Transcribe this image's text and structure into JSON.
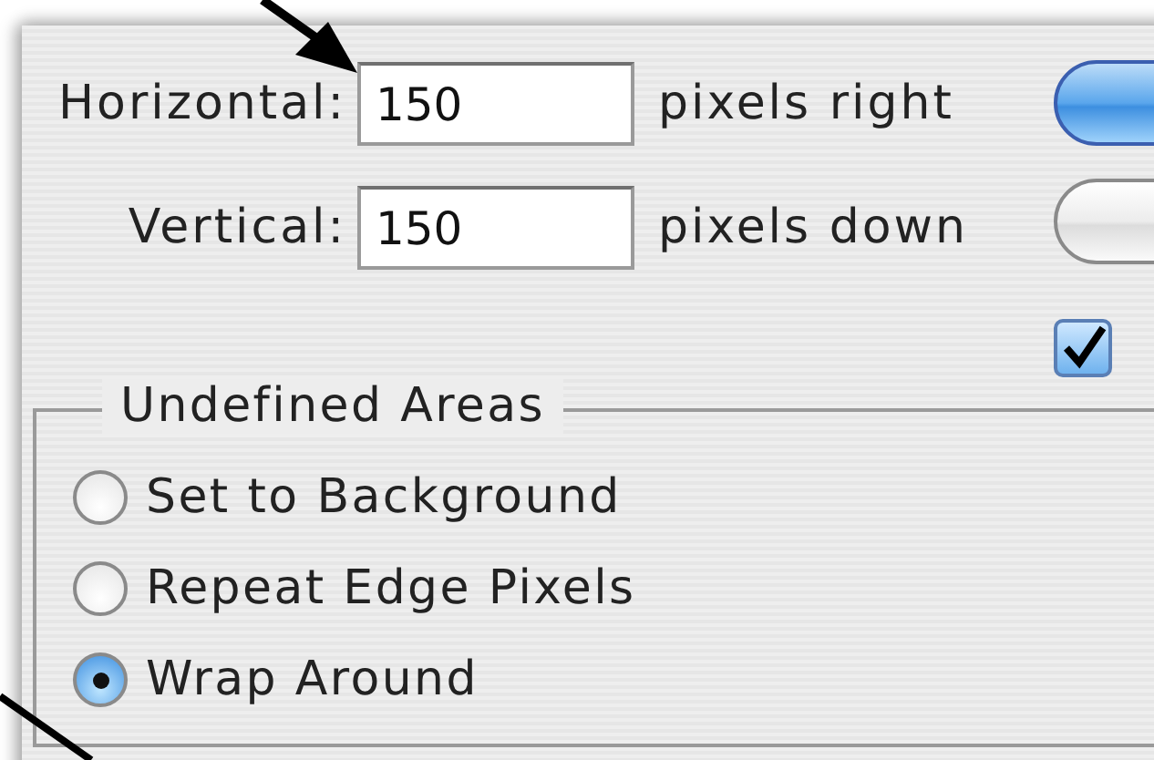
{
  "offset_fields": [
    {
      "label": "Horizontal:",
      "value": "150",
      "unit": "pixels right"
    },
    {
      "label": "Vertical:",
      "value": "150",
      "unit": "pixels down"
    }
  ],
  "buttons": [
    {
      "kind": "default"
    },
    {
      "kind": "plain"
    }
  ],
  "preview_checkbox": {
    "checked": true
  },
  "undefined_areas": {
    "title": "Undefined Areas",
    "options": [
      {
        "label": "Set to Background",
        "selected": false
      },
      {
        "label": "Repeat Edge Pixels",
        "selected": false
      },
      {
        "label": "Wrap Around",
        "selected": true
      }
    ]
  }
}
